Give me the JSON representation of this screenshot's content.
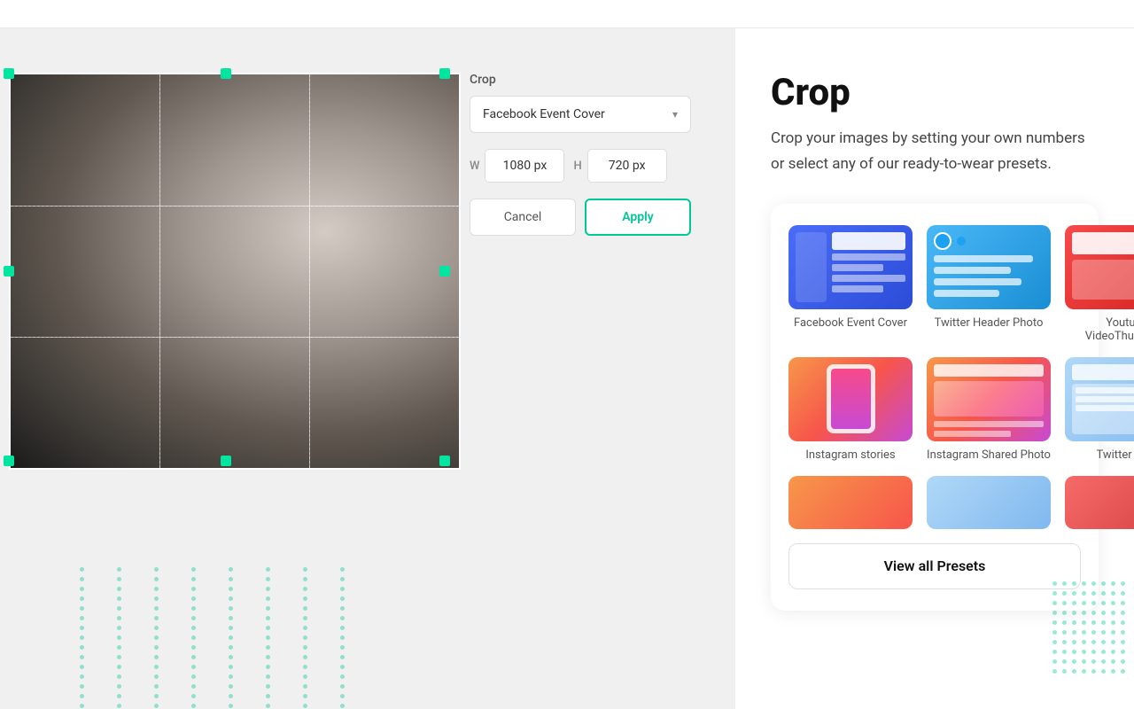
{
  "topbar": {},
  "crop_panel": {
    "label": "Crop",
    "preset_selected": "Facebook Event Cover",
    "width_label": "W",
    "width_value": "1080 px",
    "height_label": "H",
    "height_value": "720 px",
    "cancel_label": "Cancel",
    "apply_label": "Apply"
  },
  "info_panel": {
    "title": "Crop",
    "description": "Crop your images by setting your own numbers or select any of our ready-to-wear presets."
  },
  "presets": {
    "items": [
      {
        "name": "Facebook Event Cover",
        "type": "facebook"
      },
      {
        "name": "Twitter Header Photo",
        "type": "twitter-header"
      },
      {
        "name": "Youtube VideoThumbnail",
        "type": "youtube"
      },
      {
        "name": "Instagram stories",
        "type": "ig-stories"
      },
      {
        "name": "Instagram Shared Photo",
        "type": "ig-shared"
      },
      {
        "name": "Twitter post",
        "type": "twitter-post"
      }
    ],
    "view_all_label": "View all Presets"
  }
}
